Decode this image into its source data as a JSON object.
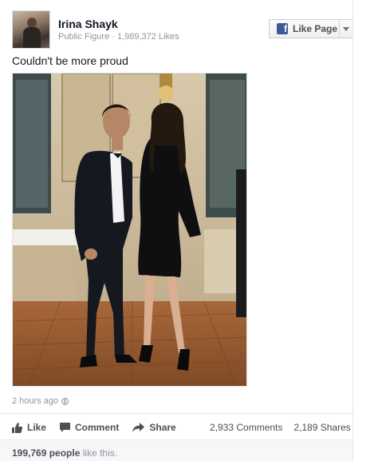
{
  "post": {
    "page_name": "Irina Shayk",
    "page_category": "Public Figure",
    "page_likes": "1,989,372 Likes",
    "like_page_label": "Like Page",
    "caption": "Couldn't be more proud",
    "timestamp": "2 hours ago"
  },
  "actions": {
    "like": "Like",
    "comment": "Comment",
    "share": "Share"
  },
  "stats": {
    "comments": "2,933 Comments",
    "shares": "2,189 Shares",
    "likes_count": "199,769 people",
    "likes_suffix": "like this."
  },
  "colors": {
    "fb_blue": "#3b5998",
    "text_primary": "#141823",
    "text_secondary": "#90949c"
  },
  "icons": [
    "facebook-icon",
    "dropdown-caret-icon",
    "globe-icon",
    "thumbs-up-icon",
    "comment-icon",
    "share-icon"
  ]
}
